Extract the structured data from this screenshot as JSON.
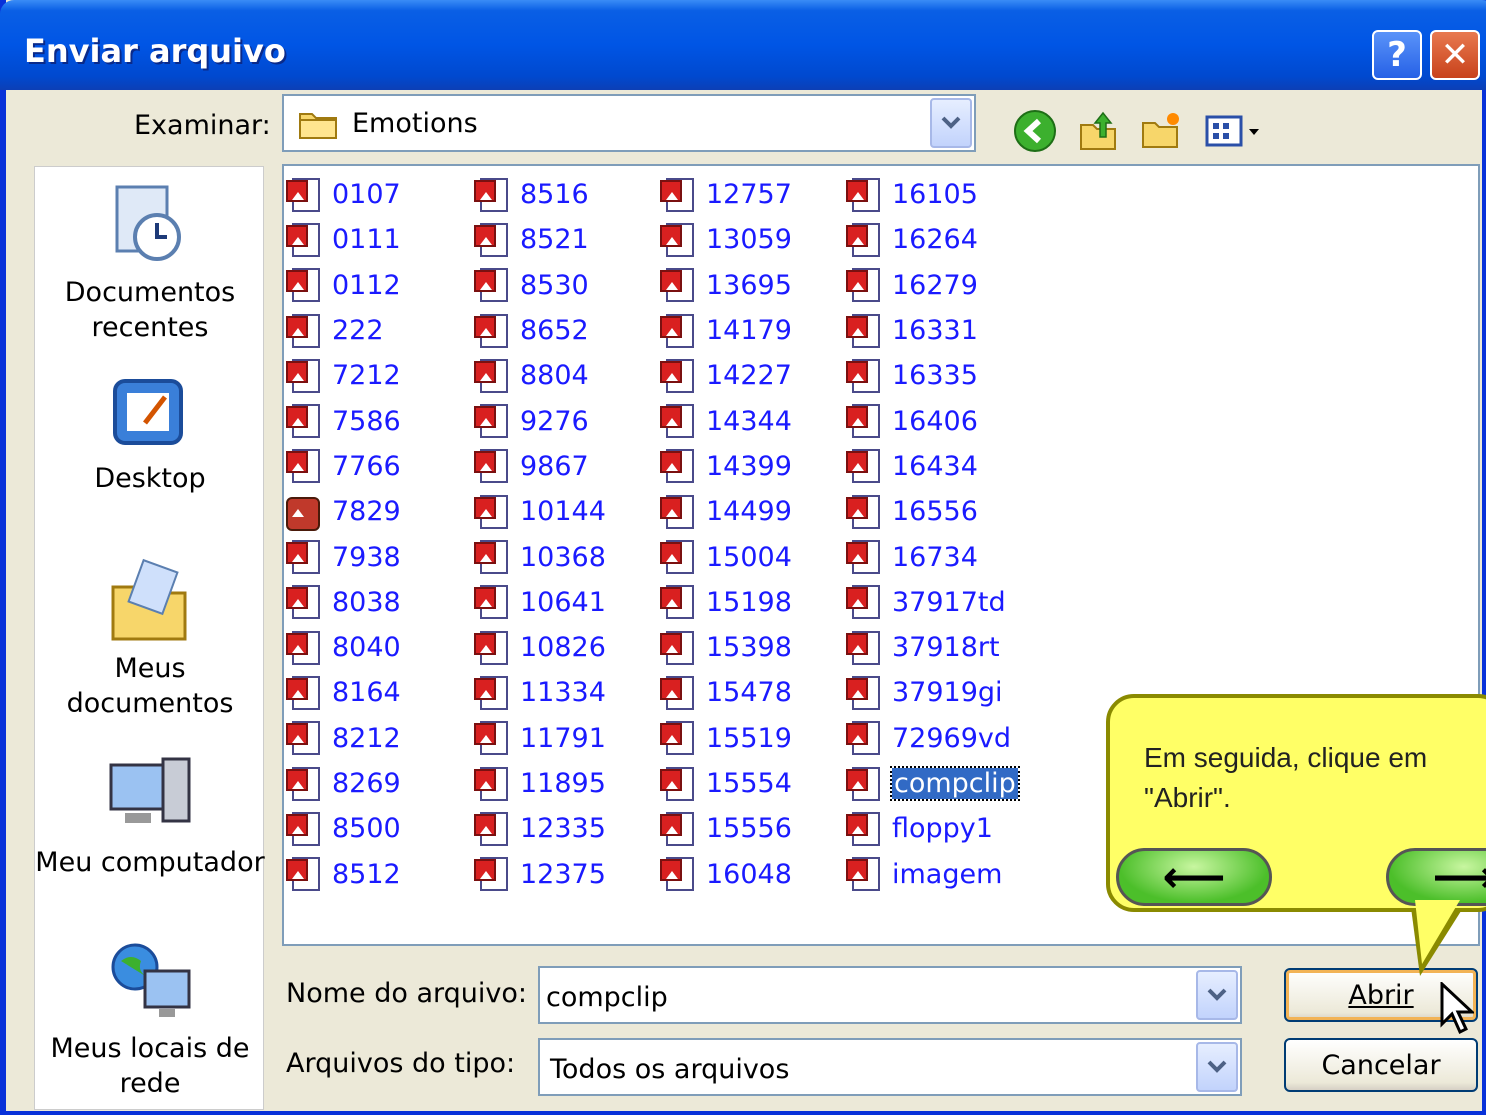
{
  "window": {
    "title": "Enviar arquivo",
    "help_label": "?",
    "close_label": "✕"
  },
  "lookin": {
    "label": "Examinar:",
    "value": "Emotions"
  },
  "places": [
    {
      "label": "Documentos recentes",
      "icon": "recent-documents-icon"
    },
    {
      "label": "Desktop",
      "icon": "desktop-icon"
    },
    {
      "label": "Meus documentos",
      "icon": "my-documents-icon"
    },
    {
      "label": "Meu computador",
      "icon": "my-computer-icon"
    },
    {
      "label": "Meus locais de rede",
      "icon": "network-places-icon"
    }
  ],
  "files": {
    "col1": [
      "0107",
      "0111",
      "0112",
      "222",
      "7212",
      "7586",
      "7766",
      "7829",
      "7938",
      "8038",
      "8040",
      "8164",
      "8212",
      "8269",
      "8500",
      "8512"
    ],
    "col2": [
      "8516",
      "8521",
      "8530",
      "8652",
      "8804",
      "9276",
      "9867",
      "10144",
      "10368",
      "10641",
      "10826",
      "11334",
      "11791",
      "11895",
      "12335",
      "12375"
    ],
    "col3": [
      "12757",
      "13059",
      "13695",
      "14179",
      "14227",
      "14344",
      "14399",
      "14499",
      "15004",
      "15198",
      "15398",
      "15478",
      "15519",
      "15554",
      "15556",
      "16048"
    ],
    "col4": [
      "16105",
      "16264",
      "16279",
      "16331",
      "16335",
      "16406",
      "16434",
      "16556",
      "16734",
      "37917td",
      "37918rt",
      "37919gi",
      "72969vd",
      "compclip",
      "floppy1",
      "imagem"
    ]
  },
  "selected_file": "compclip",
  "filename": {
    "label": "Nome do arquivo:",
    "value": "compclip"
  },
  "filetype": {
    "label": "Arquivos do tipo:",
    "value": "Todos os arquivos"
  },
  "buttons": {
    "open": "Abrir",
    "cancel": "Cancelar"
  },
  "tooltip": {
    "line1": "Em seguida, clique em",
    "line2": "\"Abrir\".",
    "back": "⟵",
    "next": "⟶"
  }
}
